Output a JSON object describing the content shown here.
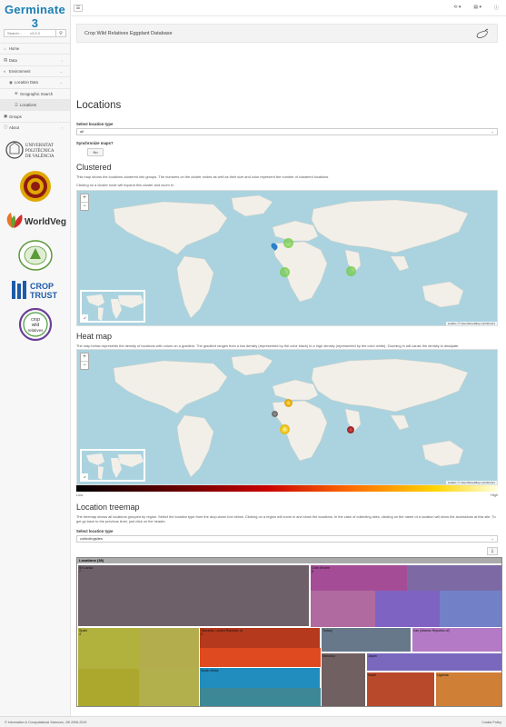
{
  "app": {
    "name": "Germinate 3",
    "version": "v3.5.0"
  },
  "sidebar": {
    "search_placeholder": "Search...",
    "items": [
      {
        "label": "Home",
        "icon": "home-icon"
      },
      {
        "label": "Data",
        "icon": "database-icon"
      },
      {
        "label": "Environment",
        "icon": "globe-icon"
      },
      {
        "label": "Location Data",
        "icon": "map-marker-icon"
      },
      {
        "label": "Geographic Search",
        "icon": "crosshair-icon"
      },
      {
        "label": "Locations",
        "icon": "list-icon"
      },
      {
        "label": "Groups",
        "icon": "folder-icon"
      },
      {
        "label": "About",
        "icon": "info-icon"
      }
    ],
    "partners": [
      {
        "name": "UNIVERSITAT POLITÈCNICA DE VALÈNCIA",
        "lines": [
          "UNIVERSITAT",
          "POLITÈCNICA",
          "DE VALÈNCIA"
        ]
      },
      {
        "name": "seal"
      },
      {
        "name": "WorldVeg"
      },
      {
        "name": "UNIVERSITE FELIX HOUPHOUET BOIGNY"
      },
      {
        "name": "CROP TRUST",
        "lines": [
          "CROP",
          "TRUST"
        ]
      },
      {
        "name": "crop wild relatives",
        "lines": [
          "crop",
          "wild",
          "relatives"
        ]
      }
    ]
  },
  "banner": {
    "title": "Crop Wild Relatives Eggplant Database"
  },
  "page": {
    "title": "Locations",
    "location_type_label": "Select location type",
    "location_type_value": "all",
    "sync_label": "Synchronize maps?",
    "sync_button": "No"
  },
  "clustered": {
    "title": "Clustered",
    "desc1": "This map shows the locations clustered into groups. The numbers on the cluster nodes as well as their size and color represent the number of clustered locations.",
    "desc2": "Clicking on a cluster node will expand this cluster and zoom in.",
    "zoom_in": "+",
    "zoom_out": "−",
    "attribution": "Leaflet | © OpenStreetMap contributors"
  },
  "heatmap": {
    "title": "Heat map",
    "desc": "The map below represents the density of locations with colors on a gradient. The gradient ranges from a low density (represented by the color black) to a high density (represented by the color white). Zooming in will cause the density to dissipate.",
    "legend_low": "Low",
    "legend_high": "High",
    "attribution": "Leaflet | © OpenStreetMap contributors"
  },
  "treemap": {
    "title": "Location treemap",
    "desc": "The treemap shows all locations grouped by region. Select the location type from the drop-down box below. Clicking on a region will zoom in and show the locations. In the case of collecting sites, clicking on the name of a location will show the accessions at this site. To get go back to the previous level, just click on the header.",
    "type_label": "Select location type",
    "type_value": "collectingsites",
    "header": "Locations (38)",
    "regions": [
      {
        "name": "Sri Lanka",
        "count": "7",
        "color": "#6e6068"
      },
      {
        "name": "Côte d'Ivoire",
        "count": "6",
        "color": "#a54c97"
      },
      {
        "name": "Spain",
        "count": "4",
        "color": "#b1b13e"
      },
      {
        "name": "Tanzania, United Republic of",
        "count": "4",
        "color": "#b5391c"
      },
      {
        "name": "South Africa",
        "count": "",
        "color": "#218cbe"
      },
      {
        "name": "Turkey",
        "count": "",
        "color": "#66788a"
      },
      {
        "name": "Iran (Islamic Republic of)",
        "count": "",
        "color": "#b57ac6"
      },
      {
        "name": "Morocco",
        "count": "",
        "color": "#706062"
      },
      {
        "name": "Japan",
        "count": "",
        "color": "#7a68be"
      },
      {
        "name": "Israel",
        "count": "",
        "color": "#b84a2b"
      },
      {
        "name": "Uganda",
        "count": "",
        "color": "#d07f37"
      }
    ]
  },
  "footer": {
    "left": "© Information & Computational Sciences, JHI 2006-2019",
    "right": "Cookie Policy"
  },
  "colors": {
    "brand": "#1a7fb6",
    "water": "#aad3df",
    "land": "#f2efe9"
  }
}
